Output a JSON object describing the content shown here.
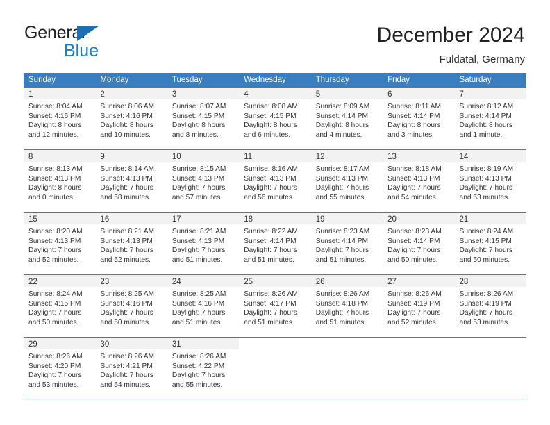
{
  "logo": {
    "word1": "General",
    "word2": "Blue",
    "triangle_color": "#1a6fb5",
    "blue_color": "#1a7cc4"
  },
  "header": {
    "title": "December 2024",
    "subtitle": "Fuldatal, Germany",
    "header_bg": "#3a7ebf",
    "day_band_bg": "#f2f2f2"
  },
  "weekdays": [
    "Sunday",
    "Monday",
    "Tuesday",
    "Wednesday",
    "Thursday",
    "Friday",
    "Saturday"
  ],
  "weeks": [
    [
      {
        "day": "1",
        "sunrise": "Sunrise: 8:04 AM",
        "sunset": "Sunset: 4:16 PM",
        "daylight1": "Daylight: 8 hours",
        "daylight2": "and 12 minutes."
      },
      {
        "day": "2",
        "sunrise": "Sunrise: 8:06 AM",
        "sunset": "Sunset: 4:16 PM",
        "daylight1": "Daylight: 8 hours",
        "daylight2": "and 10 minutes."
      },
      {
        "day": "3",
        "sunrise": "Sunrise: 8:07 AM",
        "sunset": "Sunset: 4:15 PM",
        "daylight1": "Daylight: 8 hours",
        "daylight2": "and 8 minutes."
      },
      {
        "day": "4",
        "sunrise": "Sunrise: 8:08 AM",
        "sunset": "Sunset: 4:15 PM",
        "daylight1": "Daylight: 8 hours",
        "daylight2": "and 6 minutes."
      },
      {
        "day": "5",
        "sunrise": "Sunrise: 8:09 AM",
        "sunset": "Sunset: 4:14 PM",
        "daylight1": "Daylight: 8 hours",
        "daylight2": "and 4 minutes."
      },
      {
        "day": "6",
        "sunrise": "Sunrise: 8:11 AM",
        "sunset": "Sunset: 4:14 PM",
        "daylight1": "Daylight: 8 hours",
        "daylight2": "and 3 minutes."
      },
      {
        "day": "7",
        "sunrise": "Sunrise: 8:12 AM",
        "sunset": "Sunset: 4:14 PM",
        "daylight1": "Daylight: 8 hours",
        "daylight2": "and 1 minute."
      }
    ],
    [
      {
        "day": "8",
        "sunrise": "Sunrise: 8:13 AM",
        "sunset": "Sunset: 4:13 PM",
        "daylight1": "Daylight: 8 hours",
        "daylight2": "and 0 minutes."
      },
      {
        "day": "9",
        "sunrise": "Sunrise: 8:14 AM",
        "sunset": "Sunset: 4:13 PM",
        "daylight1": "Daylight: 7 hours",
        "daylight2": "and 58 minutes."
      },
      {
        "day": "10",
        "sunrise": "Sunrise: 8:15 AM",
        "sunset": "Sunset: 4:13 PM",
        "daylight1": "Daylight: 7 hours",
        "daylight2": "and 57 minutes."
      },
      {
        "day": "11",
        "sunrise": "Sunrise: 8:16 AM",
        "sunset": "Sunset: 4:13 PM",
        "daylight1": "Daylight: 7 hours",
        "daylight2": "and 56 minutes."
      },
      {
        "day": "12",
        "sunrise": "Sunrise: 8:17 AM",
        "sunset": "Sunset: 4:13 PM",
        "daylight1": "Daylight: 7 hours",
        "daylight2": "and 55 minutes."
      },
      {
        "day": "13",
        "sunrise": "Sunrise: 8:18 AM",
        "sunset": "Sunset: 4:13 PM",
        "daylight1": "Daylight: 7 hours",
        "daylight2": "and 54 minutes."
      },
      {
        "day": "14",
        "sunrise": "Sunrise: 8:19 AM",
        "sunset": "Sunset: 4:13 PM",
        "daylight1": "Daylight: 7 hours",
        "daylight2": "and 53 minutes."
      }
    ],
    [
      {
        "day": "15",
        "sunrise": "Sunrise: 8:20 AM",
        "sunset": "Sunset: 4:13 PM",
        "daylight1": "Daylight: 7 hours",
        "daylight2": "and 52 minutes."
      },
      {
        "day": "16",
        "sunrise": "Sunrise: 8:21 AM",
        "sunset": "Sunset: 4:13 PM",
        "daylight1": "Daylight: 7 hours",
        "daylight2": "and 52 minutes."
      },
      {
        "day": "17",
        "sunrise": "Sunrise: 8:21 AM",
        "sunset": "Sunset: 4:13 PM",
        "daylight1": "Daylight: 7 hours",
        "daylight2": "and 51 minutes."
      },
      {
        "day": "18",
        "sunrise": "Sunrise: 8:22 AM",
        "sunset": "Sunset: 4:14 PM",
        "daylight1": "Daylight: 7 hours",
        "daylight2": "and 51 minutes."
      },
      {
        "day": "19",
        "sunrise": "Sunrise: 8:23 AM",
        "sunset": "Sunset: 4:14 PM",
        "daylight1": "Daylight: 7 hours",
        "daylight2": "and 51 minutes."
      },
      {
        "day": "20",
        "sunrise": "Sunrise: 8:23 AM",
        "sunset": "Sunset: 4:14 PM",
        "daylight1": "Daylight: 7 hours",
        "daylight2": "and 50 minutes."
      },
      {
        "day": "21",
        "sunrise": "Sunrise: 8:24 AM",
        "sunset": "Sunset: 4:15 PM",
        "daylight1": "Daylight: 7 hours",
        "daylight2": "and 50 minutes."
      }
    ],
    [
      {
        "day": "22",
        "sunrise": "Sunrise: 8:24 AM",
        "sunset": "Sunset: 4:15 PM",
        "daylight1": "Daylight: 7 hours",
        "daylight2": "and 50 minutes."
      },
      {
        "day": "23",
        "sunrise": "Sunrise: 8:25 AM",
        "sunset": "Sunset: 4:16 PM",
        "daylight1": "Daylight: 7 hours",
        "daylight2": "and 50 minutes."
      },
      {
        "day": "24",
        "sunrise": "Sunrise: 8:25 AM",
        "sunset": "Sunset: 4:16 PM",
        "daylight1": "Daylight: 7 hours",
        "daylight2": "and 51 minutes."
      },
      {
        "day": "25",
        "sunrise": "Sunrise: 8:26 AM",
        "sunset": "Sunset: 4:17 PM",
        "daylight1": "Daylight: 7 hours",
        "daylight2": "and 51 minutes."
      },
      {
        "day": "26",
        "sunrise": "Sunrise: 8:26 AM",
        "sunset": "Sunset: 4:18 PM",
        "daylight1": "Daylight: 7 hours",
        "daylight2": "and 51 minutes."
      },
      {
        "day": "27",
        "sunrise": "Sunrise: 8:26 AM",
        "sunset": "Sunset: 4:19 PM",
        "daylight1": "Daylight: 7 hours",
        "daylight2": "and 52 minutes."
      },
      {
        "day": "28",
        "sunrise": "Sunrise: 8:26 AM",
        "sunset": "Sunset: 4:19 PM",
        "daylight1": "Daylight: 7 hours",
        "daylight2": "and 53 minutes."
      }
    ],
    [
      {
        "day": "29",
        "sunrise": "Sunrise: 8:26 AM",
        "sunset": "Sunset: 4:20 PM",
        "daylight1": "Daylight: 7 hours",
        "daylight2": "and 53 minutes."
      },
      {
        "day": "30",
        "sunrise": "Sunrise: 8:26 AM",
        "sunset": "Sunset: 4:21 PM",
        "daylight1": "Daylight: 7 hours",
        "daylight2": "and 54 minutes."
      },
      {
        "day": "31",
        "sunrise": "Sunrise: 8:26 AM",
        "sunset": "Sunset: 4:22 PM",
        "daylight1": "Daylight: 7 hours",
        "daylight2": "and 55 minutes."
      },
      {
        "day": "",
        "sunrise": "",
        "sunset": "",
        "daylight1": "",
        "daylight2": ""
      },
      {
        "day": "",
        "sunrise": "",
        "sunset": "",
        "daylight1": "",
        "daylight2": ""
      },
      {
        "day": "",
        "sunrise": "",
        "sunset": "",
        "daylight1": "",
        "daylight2": ""
      },
      {
        "day": "",
        "sunrise": "",
        "sunset": "",
        "daylight1": "",
        "daylight2": ""
      }
    ]
  ]
}
